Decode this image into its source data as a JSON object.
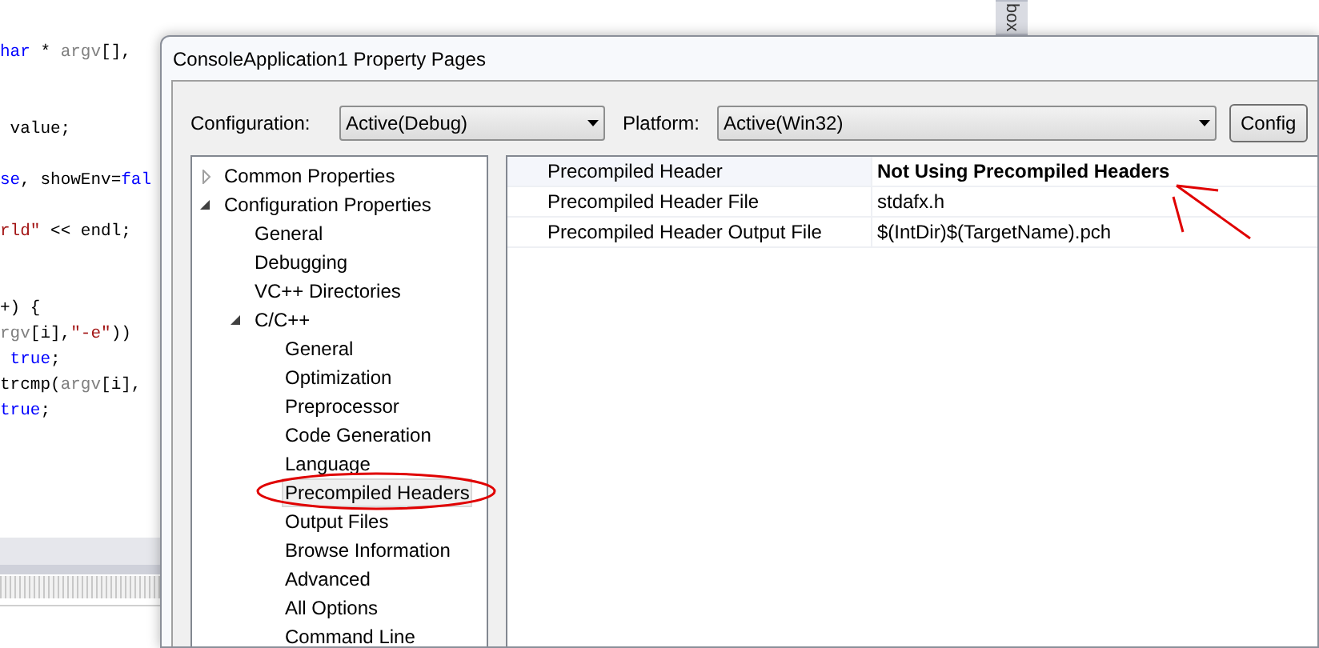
{
  "editor": {
    "lines": [
      [
        {
          "kind": "keyword",
          "text": "har"
        },
        {
          "kind": "plain",
          "text": " * "
        },
        {
          "kind": "param",
          "text": "argv"
        },
        {
          "kind": "plain",
          "text": "[], "
        }
      ],
      [
        {
          "kind": "plain",
          "text": " value;"
        }
      ],
      [
        {
          "kind": "keyword",
          "text": "se"
        },
        {
          "kind": "plain",
          "text": ", showEnv="
        },
        {
          "kind": "keyword",
          "text": "fal"
        }
      ],
      [
        {
          "kind": "string",
          "text": "rld\""
        },
        {
          "kind": "plain",
          "text": " << endl;"
        }
      ],
      [
        {
          "kind": "plain",
          "text": "+) {"
        }
      ],
      [
        {
          "kind": "param",
          "text": "rgv"
        },
        {
          "kind": "plain",
          "text": "[i],"
        },
        {
          "kind": "string",
          "text": "\"-e\""
        },
        {
          "kind": "plain",
          "text": "))"
        }
      ],
      [
        {
          "kind": "keyword",
          "text": " true"
        },
        {
          "kind": "plain",
          "text": ";"
        }
      ],
      [
        {
          "kind": "plain",
          "text": "trcmp("
        },
        {
          "kind": "param",
          "text": "argv"
        },
        {
          "kind": "plain",
          "text": "[i],"
        }
      ],
      [
        {
          "kind": "keyword",
          "text": "true"
        },
        {
          "kind": "plain",
          "text": ";"
        }
      ]
    ]
  },
  "side_tab": {
    "label": "box"
  },
  "dialog": {
    "title": "ConsoleApplication1 Property Pages",
    "configuration": {
      "label": "Configuration:",
      "value": "Active(Debug)"
    },
    "platform": {
      "label": "Platform:",
      "value": "Active(Win32)"
    },
    "config_button": "Config",
    "tree": [
      {
        "label": "Common Properties",
        "expanded": false,
        "selected": false
      },
      {
        "label": "Configuration Properties",
        "expanded": true,
        "selected": false,
        "children": [
          {
            "label": "General",
            "selected": false
          },
          {
            "label": "Debugging",
            "selected": false
          },
          {
            "label": "VC++ Directories",
            "selected": false
          },
          {
            "label": "C/C++",
            "expanded": true,
            "selected": false,
            "children": [
              {
                "label": "General",
                "selected": false
              },
              {
                "label": "Optimization",
                "selected": false
              },
              {
                "label": "Preprocessor",
                "selected": false
              },
              {
                "label": "Code Generation",
                "selected": false
              },
              {
                "label": "Language",
                "selected": false
              },
              {
                "label": "Precompiled Headers",
                "selected": true
              },
              {
                "label": "Output Files",
                "selected": false
              },
              {
                "label": "Browse Information",
                "selected": false
              },
              {
                "label": "Advanced",
                "selected": false
              },
              {
                "label": "All Options",
                "selected": false
              },
              {
                "label": "Command Line",
                "selected": false
              }
            ]
          }
        ]
      }
    ],
    "properties": [
      {
        "name": "Precompiled Header",
        "value": "Not Using Precompiled Headers",
        "modified": true
      },
      {
        "name": "Precompiled Header File",
        "value": "stdafx.h",
        "modified": false
      },
      {
        "name": "Precompiled Header Output File",
        "value": "$(IntDir)$(TargetName).pch",
        "modified": false
      }
    ]
  }
}
